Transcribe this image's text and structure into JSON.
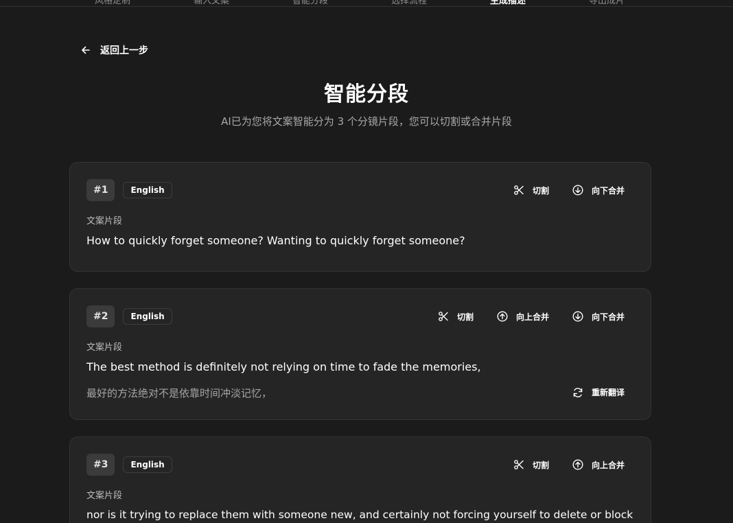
{
  "stepper": {
    "steps": [
      {
        "label": "风格定制"
      },
      {
        "label": "输入文案"
      },
      {
        "label": "智能分段"
      },
      {
        "label": "选择流程"
      },
      {
        "label": "生成描述"
      },
      {
        "label": "导出成片"
      }
    ],
    "active_step": "生成描述"
  },
  "back": {
    "label": "返回上一步",
    "icon": "arrow-left-icon"
  },
  "header": {
    "title": "智能分段",
    "subtitle": "AI已为您将文案智能分为 3 个分镜片段，您可以切割或合并片段"
  },
  "segments": [
    {
      "number": "#1",
      "language": "English",
      "field_label": "文案片段",
      "text": "How to quickly forget someone? Wanting to quickly forget someone?",
      "actions": {
        "cut": "切割",
        "merge_down": "向下合并"
      }
    },
    {
      "number": "#2",
      "language": "English",
      "field_label": "文案片段",
      "text": "The best method is definitely not relying on time to fade the memories,",
      "translation": "最好的方法绝对不是依靠时间冲淡记忆，",
      "retranslate": "重新翻译",
      "actions": {
        "cut": "切割",
        "merge_up": "向上合并",
        "merge_down": "向下合并"
      }
    },
    {
      "number": "#3",
      "language": "English",
      "field_label": "文案片段",
      "text": "nor is it trying to replace them with someone new, and certainly not forcing yourself to delete or block",
      "actions": {
        "cut": "切割",
        "merge_up": "向上合并"
      }
    }
  ],
  "icons": {
    "cut": "scissors-icon",
    "merge_up": "arrow-up-circle-icon",
    "merge_down": "arrow-down-circle-icon",
    "retranslate": "refresh-icon"
  },
  "colors": {
    "background": "#1b1b1b",
    "card": "#252525",
    "card_border": "#333333",
    "badge": "#3b3b3b",
    "muted_text": "#a8a8a8"
  }
}
